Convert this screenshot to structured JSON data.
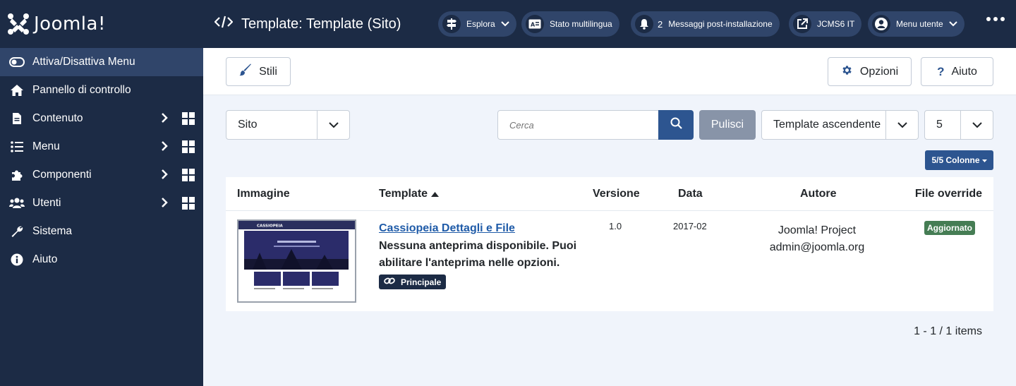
{
  "brand": {
    "name": "Joomla!"
  },
  "header": {
    "title": "Template: Template (Sito)"
  },
  "topbar": {
    "explore": "Esplora",
    "multilang": "Stato multilingua",
    "notif_count": "2",
    "post_install": "Messaggi post-installazione",
    "site_link": "JCMS6 IT",
    "user_menu": "Menu utente"
  },
  "sidebar": {
    "items": [
      {
        "label": "Attiva/Disattiva Menu"
      },
      {
        "label": "Pannello di controllo"
      },
      {
        "label": "Contenuto"
      },
      {
        "label": "Menu"
      },
      {
        "label": "Componenti"
      },
      {
        "label": "Utenti"
      },
      {
        "label": "Sistema"
      },
      {
        "label": "Aiuto"
      }
    ]
  },
  "toolbar": {
    "styles": "Stili",
    "options": "Opzioni",
    "help": "Aiuto"
  },
  "filters": {
    "client": "Sito",
    "search_placeholder": "Cerca",
    "clear": "Pulisci",
    "ordering": "Template ascendente",
    "limit": "5",
    "columns": "5/5 Colonne"
  },
  "table": {
    "headers": {
      "image": "Immagine",
      "template": "Template",
      "version": "Versione",
      "date": "Data",
      "author": "Autore",
      "overrides": "File override"
    },
    "rows": [
      {
        "name": "Cassiopeia Dettagli e File",
        "description": "Nessuna anteprima disponibile. Puoi abilitare l'anteprima nelle opzioni.",
        "badge": "Principale",
        "version": "1.0",
        "date": "2017-02",
        "author": "Joomla! Project",
        "email": "admin@joomla.org",
        "status": "Aggiornato",
        "thumb_title": "CASSIOPEIA"
      }
    ]
  },
  "pagination": {
    "summary": "1 - 1 / 1 items"
  },
  "colors": {
    "sidebar_bg": "#1c2b45",
    "active_bg": "#30456a",
    "primary": "#2d5590",
    "success": "#457d54",
    "link": "#1f5ba8"
  }
}
